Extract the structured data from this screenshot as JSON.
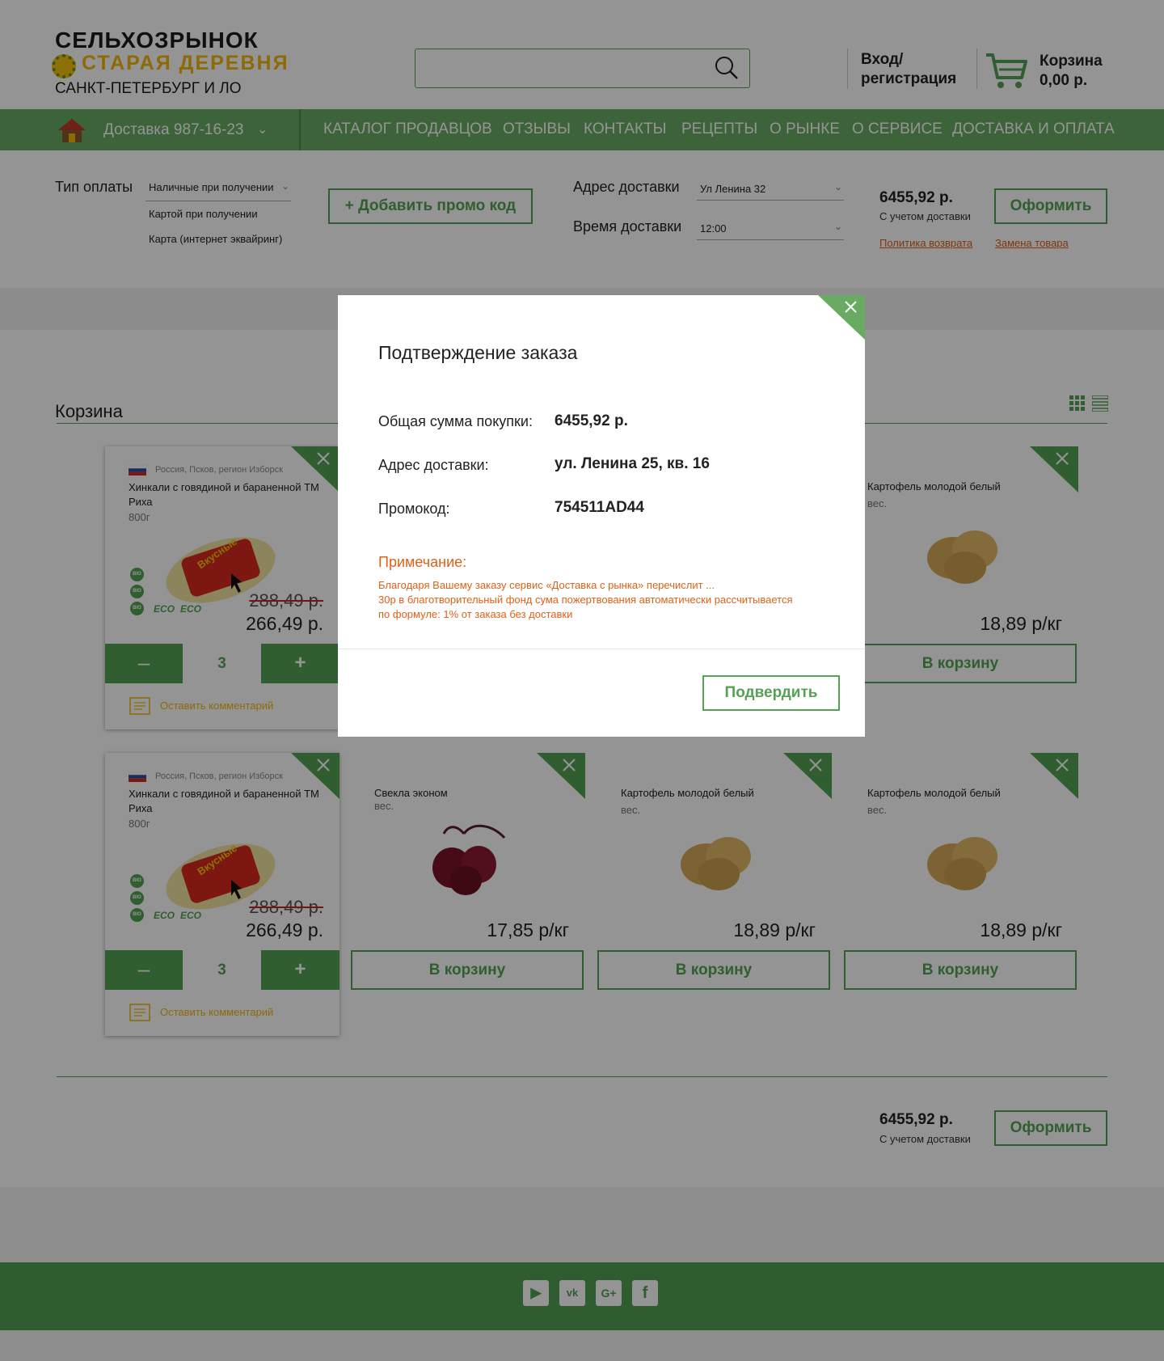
{
  "header": {
    "logo_line1": "СЕЛЬХОЗРЫНОК",
    "logo_line2": "СТАРАЯ ДЕРЕВНЯ",
    "region": "САНКТ-ПЕТЕРБУРГ И ЛО",
    "search_placeholder": "",
    "login_line1": "Вход/",
    "login_line2": "регистрация",
    "cart_label": "Корзина",
    "cart_total": "0,00 р."
  },
  "nav": {
    "delivery_phone": "Доставка 987-16-23",
    "items": [
      "КАТАЛОГ ПРОДАВЦОВ",
      "ОТЗЫВЫ",
      "КОНТАКТЫ",
      "РЕЦЕПТЫ",
      "О РЫНКЕ",
      "О СЕРВИСЕ",
      "ДОСТАВКА И ОПЛАТА"
    ]
  },
  "order": {
    "payment_label": "Тип оплаты",
    "payment_selected": "Наличные при получении",
    "payment_options": [
      "Картой при получении",
      "Карта (интернет эквайринг)"
    ],
    "promo_button": "Добавить промо код",
    "address_label": "Адрес доставки",
    "address_value": "Ул Ленина 32",
    "time_label": "Время доставки",
    "time_value": "12:00",
    "total": "6455,92 р.",
    "total_note": "С учетом доставки",
    "checkout_button": "Оформить",
    "return_policy": "Политика возврата",
    "replace_policy": "Замена товара"
  },
  "cart": {
    "title": "Корзина",
    "big_items": [
      {
        "origin": "Россия, Псков, регион Изборск",
        "name": "Хинкали с говядиной и бараненной ТМ Риха",
        "weight": "800г",
        "old_price": "288,49 р.",
        "new_price": "266,49 р.",
        "qty": "3",
        "comment": "Оставить комментарий",
        "badges": [
          "BIO",
          "BIO",
          "BIO"
        ],
        "eco": [
          "ECO",
          "ECO"
        ]
      },
      {
        "origin": "Россия, Псков, регион Изборск",
        "name": "Хинкали с говядиной и бараненной ТМ Риха",
        "weight": "800г",
        "old_price": "288,49 р.",
        "new_price": "266,49 р.",
        "qty": "3",
        "comment": "Оставить комментарий",
        "badges": [
          "BIO",
          "BIO",
          "BIO"
        ],
        "eco": [
          "ECO",
          "ECO"
        ]
      }
    ],
    "row1_item": {
      "name": "Картофель молодой белый",
      "weight": "вес.",
      "price": "18,89 р/кг",
      "button": "В корзину"
    },
    "row2_items": [
      {
        "name": "Свекла эконом",
        "weight": "вес.",
        "price": "17,85 р/кг",
        "button": "В корзину"
      },
      {
        "name": "Картофель молодой белый",
        "weight": "вес.",
        "price": "18,89 р/кг",
        "button": "В корзину"
      },
      {
        "name": "Картофель молодой белый",
        "weight": "вес.",
        "price": "18,89 р/кг",
        "button": "В корзину"
      }
    ],
    "bottom_total": "6455,92 р.",
    "bottom_note": "С учетом доставки",
    "bottom_checkout": "Оформить"
  },
  "footer": {
    "social": [
      "youtube-icon",
      "vk-icon",
      "google-plus-icon",
      "facebook-icon"
    ],
    "social_glyphs": [
      "▶",
      "vk",
      "G+",
      "f"
    ]
  },
  "modal": {
    "title": "Подтверждение заказа",
    "sum_label": "Общая сумма покупки:",
    "sum_value": "6455,92 р.",
    "address_label": "Адрес доставки:",
    "address_value": "ул. Ленина 25, кв. 16",
    "promo_label": "Промокод:",
    "promo_value": "754511AD44",
    "note_title": "Примечание:",
    "note_line1": "Благодаря Вашему заказу сервис «Доставка с рынка» перечислит ...",
    "note_line2": "30р в благотворительный фонд сума пожертвования автоматически рассчитывается",
    "note_line3": "по формуле: 1% от заказа без доставки",
    "confirm_button": "Подвердить"
  },
  "colors": {
    "accent_green": "#55a255",
    "nav_green": "#6aab64",
    "warning_orange": "#e06018",
    "logo_yellow": "#f3b70c"
  }
}
